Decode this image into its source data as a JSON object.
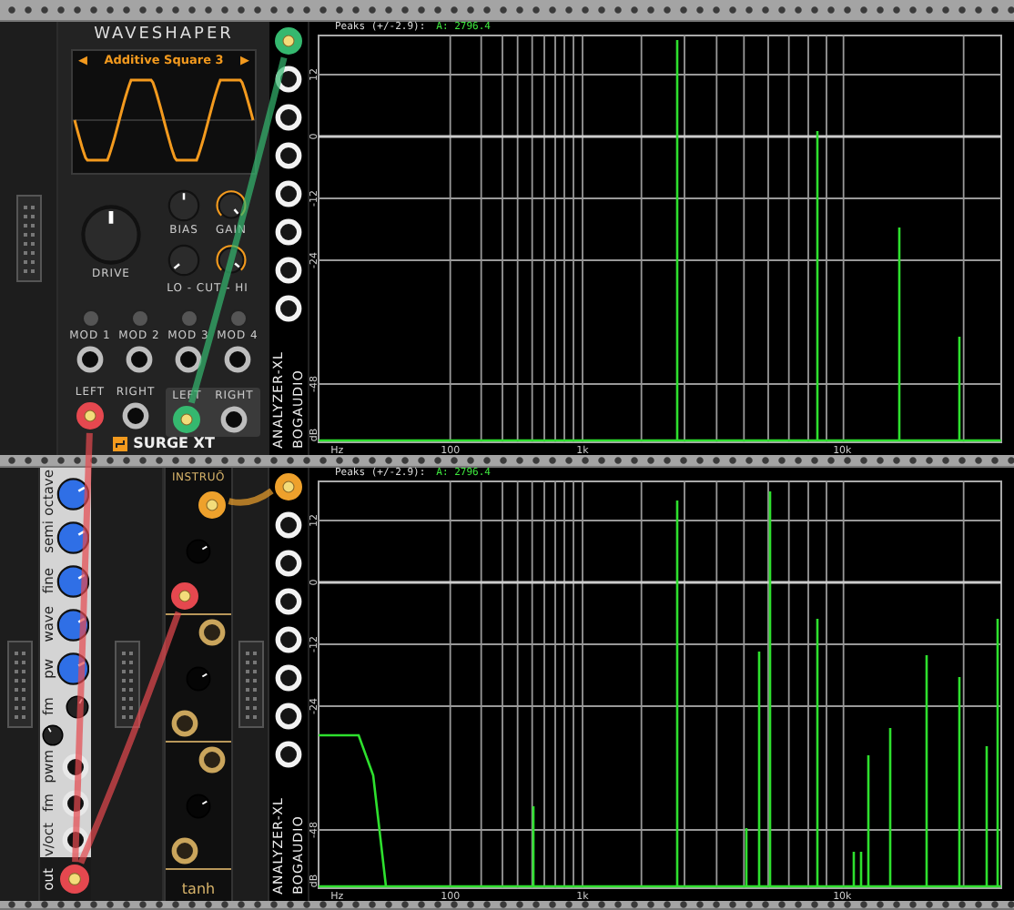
{
  "waveshaper": {
    "title": "WAVESHAPER",
    "display": {
      "prev_arrow": "◀",
      "preset": "Additive Square 3",
      "next_arrow": "▶"
    },
    "drive_label": "DRIVE",
    "bias_label": "BIAS",
    "gain_label": "GAIN",
    "cut_label": "LO - CUT - HI",
    "mod_labels": [
      "MOD 1",
      "MOD 2",
      "MOD 3",
      "MOD 4"
    ],
    "input_labels": [
      "LEFT",
      "RIGHT"
    ],
    "output_labels": [
      "LEFT",
      "RIGHT"
    ],
    "brand": "SURGE XT"
  },
  "analyzers": [
    {
      "header": "Peaks (+/-2.9):",
      "readout": "A: 2796.4",
      "y_labels": [
        "12",
        "0",
        "-12",
        "-24",
        "-48",
        "dB"
      ],
      "x_labels": [
        "Hz",
        "100",
        "1k",
        "10k"
      ],
      "module_name": "ANALYZER-XL",
      "brand": "BOGAUDIO"
    },
    {
      "header": "Peaks (+/-2.9):",
      "readout": "A: 2796.4",
      "y_labels": [
        "12",
        "0",
        "-12",
        "-24",
        "-48",
        "dB"
      ],
      "x_labels": [
        "Hz",
        "100",
        "1k",
        "10k"
      ],
      "module_name": "ANALYZER-XL",
      "brand": "BOGAUDIO"
    }
  ],
  "vco": {
    "controls": [
      {
        "label": "octave",
        "kind": "knob"
      },
      {
        "label": "semi",
        "kind": "knob"
      },
      {
        "label": "fine",
        "kind": "knob"
      },
      {
        "label": "wave",
        "kind": "knob"
      },
      {
        "label": "pw",
        "kind": "knob"
      },
      {
        "label": "fm",
        "kind": "small-knob"
      },
      {
        "kind": "attenuator"
      },
      {
        "label": "pwm",
        "kind": "jack"
      },
      {
        "label": "fm",
        "kind": "jack"
      },
      {
        "label": "v/oct",
        "kind": "jack"
      },
      {
        "label": "out",
        "kind": "output"
      }
    ]
  },
  "tanh": {
    "brand": "INSTRUŌ",
    "title": "tanh"
  },
  "cables": [
    {
      "color": "#35b86f"
    },
    {
      "color": "#e5484f"
    },
    {
      "color": "#e5484f"
    },
    {
      "color": "#eea12c"
    }
  ]
}
